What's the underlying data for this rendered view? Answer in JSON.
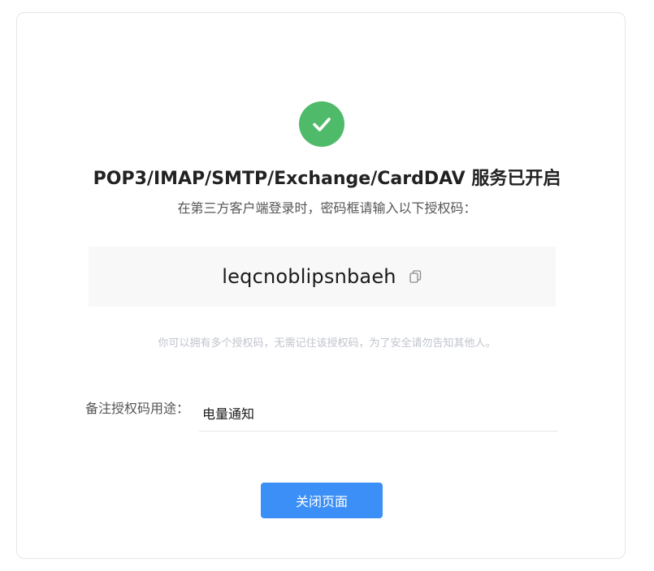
{
  "result": {
    "icon": "check-circle-icon",
    "accent_color": "#4fbb6a",
    "title": "POP3/IMAP/SMTP/Exchange/CardDAV 服务已开启",
    "subtitle": "在第三方客户端登录时，密码框请输入以下授权码："
  },
  "auth_code": {
    "value": "leqcnoblipsnbaeh",
    "copy_icon": "copy-icon"
  },
  "hint": "你可以拥有多个授权码，无需记住该授权码，为了安全请勿告知其他人。",
  "note": {
    "label": "备注授权码用途：",
    "value": "电量通知"
  },
  "actions": {
    "close_label": "关闭页面",
    "button_color": "#3b8ff6"
  }
}
